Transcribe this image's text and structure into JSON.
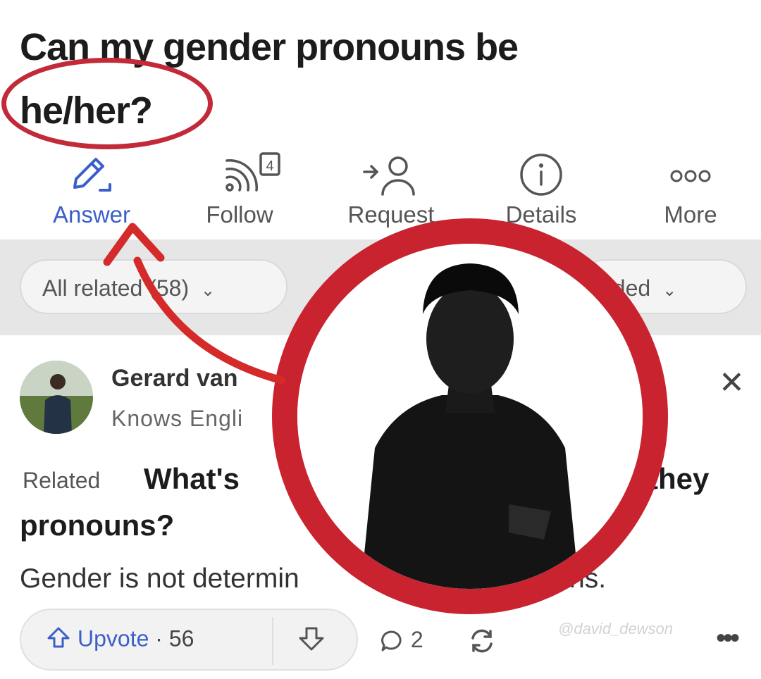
{
  "question": {
    "title_line1": "Can my gender pronouns be",
    "title_line2": "he/her?"
  },
  "actions": [
    {
      "label": "Answer",
      "icon": "pencil-icon",
      "active": true
    },
    {
      "label": "Follow",
      "icon": "rss-follow-icon",
      "badge": "4"
    },
    {
      "label": "Request",
      "icon": "request-person-icon"
    },
    {
      "label": "Details",
      "icon": "info-icon"
    },
    {
      "label": "More",
      "icon": "more-dots-icon"
    }
  ],
  "filters": {
    "related_label": "All related (58)",
    "sort_label": "nded"
  },
  "post": {
    "author": "Gerard van",
    "credential": "Knows Engli",
    "close_icon": "close-icon",
    "related_tag": "Related",
    "question_part1": "What's",
    "question_part2": "they",
    "question_part3": "pronouns?",
    "body_part1": "Gender is not determin",
    "body_part2": "ns."
  },
  "vote_bar": {
    "upvote_label": "Upvote",
    "upvote_count": "56",
    "comment_count": "2"
  },
  "watermark": "@david_dewson",
  "colors": {
    "highlight_red": "#c8232f",
    "accent_blue": "#3b5fc9",
    "band_gray": "#e6e6e6"
  }
}
